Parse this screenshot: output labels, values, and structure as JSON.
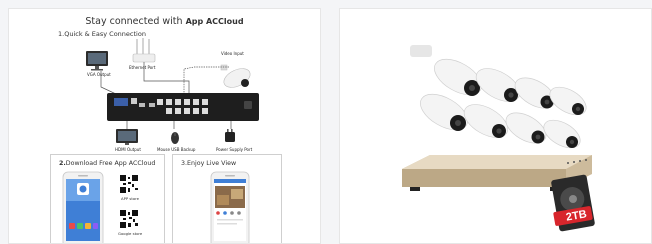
{
  "left_card": {
    "headline_prefix": "Stay connected with",
    "headline_brand": "App ACCloud",
    "step1_title": "1.Quick & Easy Connection",
    "labels": {
      "vga_output": "VGA Output",
      "ethernet_port": "Ethernet Port",
      "video_input": "Video Input",
      "hdmi_output": "HDMI Output",
      "mouse_usb_backup": "Mouse USB Backup",
      "power_supply_port": "Power Supply Port"
    },
    "step2": {
      "number": "2.",
      "title": "Download  Free App ACCloud"
    },
    "step3": {
      "title": "3.Enjoy Live View"
    },
    "qr": {
      "app_store": "APP store",
      "google_store": "Google store"
    }
  },
  "right_card": {
    "hdd_badge": "2TB"
  },
  "colors": {
    "background": "#f4f5f7",
    "card": "#ffffff",
    "hdd_red": "#d8262c"
  }
}
